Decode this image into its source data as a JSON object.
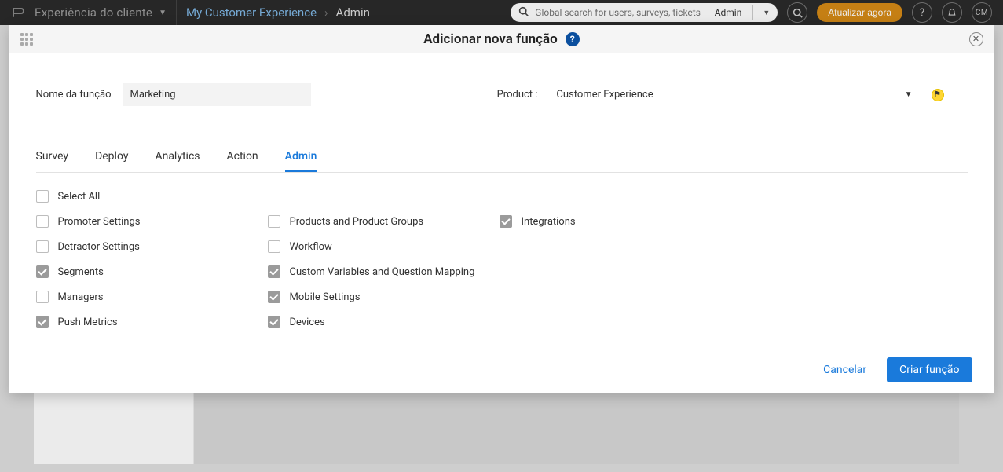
{
  "topbar": {
    "brand": "Experiência do cliente",
    "breadcrumb": {
      "link1": "My Customer Experience",
      "link2": "Admin"
    },
    "search_placeholder": "Global search for users, surveys, tickets",
    "search_role": "Admin",
    "upgrade_label": "Atualizar agora",
    "avatar_initials": "CM"
  },
  "modal": {
    "title": "Adicionar nova função",
    "role_label": "Nome da função",
    "role_value": "Marketing",
    "product_label": "Product :",
    "product_value": "Customer Experience",
    "tabs": {
      "survey": "Survey",
      "deploy": "Deploy",
      "analytics": "Analytics",
      "action": "Action",
      "admin": "Admin"
    },
    "checks": {
      "select_all": {
        "label": "Select All",
        "checked": false
      },
      "col1": [
        {
          "key": "promoter",
          "label": "Promoter Settings",
          "checked": false
        },
        {
          "key": "detractor",
          "label": "Detractor Settings",
          "checked": false
        },
        {
          "key": "segments",
          "label": "Segments",
          "checked": true
        },
        {
          "key": "managers",
          "label": "Managers",
          "checked": false
        },
        {
          "key": "push",
          "label": "Push Metrics",
          "checked": true
        }
      ],
      "col2": [
        {
          "key": "products",
          "label": "Products and Product Groups",
          "checked": false
        },
        {
          "key": "workflow",
          "label": "Workflow",
          "checked": false
        },
        {
          "key": "cvqm",
          "label": "Custom Variables and Question Mapping",
          "checked": true
        },
        {
          "key": "mobile",
          "label": "Mobile Settings",
          "checked": true
        },
        {
          "key": "devices",
          "label": "Devices",
          "checked": true
        }
      ],
      "col3": [
        {
          "key": "integrations",
          "label": "Integrations",
          "checked": true
        }
      ]
    },
    "cancel_label": "Cancelar",
    "create_label": "Criar função"
  }
}
